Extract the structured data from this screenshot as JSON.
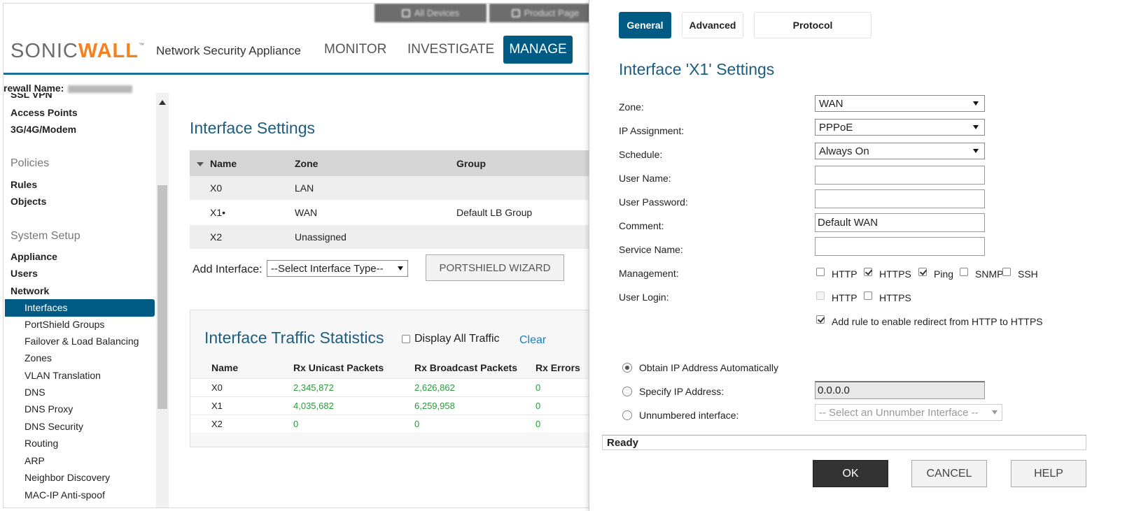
{
  "top_tabs": [
    {
      "label": "All Devices"
    },
    {
      "label": "Product Page"
    }
  ],
  "header": {
    "logo_part1": "SONIC",
    "logo_part2": "WALL",
    "logo_tm": "™",
    "product": "Network Security Appliance",
    "nav": [
      {
        "label": "MONITOR",
        "active": false
      },
      {
        "label": "INVESTIGATE",
        "active": false
      },
      {
        "label": "MANAGE",
        "active": true
      }
    ]
  },
  "firewall_name_label": "rewall Name:",
  "sidebar": {
    "cutoff_item": "SSL VPN",
    "items_top": [
      "Access Points",
      "3G/4G/Modem"
    ],
    "group_policies": "Policies",
    "policies_items": [
      "Rules",
      "Objects"
    ],
    "group_system": "System Setup",
    "system_items": [
      "Appliance",
      "Users",
      "Network"
    ],
    "active_item": "Interfaces",
    "network_items": [
      "PortShield Groups",
      "Failover & Load Balancing",
      "Zones",
      "VLAN Translation",
      "DNS",
      "DNS Proxy",
      "DNS Security",
      "Routing",
      "ARP",
      "Neighbor Discovery",
      "MAC-IP Anti-spoof"
    ]
  },
  "interface_settings": {
    "title": "Interface Settings",
    "columns": [
      "Name",
      "Zone",
      "Group"
    ],
    "rows": [
      {
        "name": "X0",
        "zone": "LAN",
        "group": ""
      },
      {
        "name": "X1•",
        "zone": "WAN",
        "group": "Default LB Group"
      },
      {
        "name": "X2",
        "zone": "Unassigned",
        "group": ""
      }
    ],
    "add_interface_label": "Add Interface:",
    "add_interface_select": "--Select Interface Type--",
    "portshield_button": "PORTSHIELD WIZARD"
  },
  "traffic_stats": {
    "title": "Interface Traffic Statistics",
    "display_all_label": "Display All Traffic",
    "clear_label": "Clear",
    "columns": [
      "Name",
      "Rx Unicast Packets",
      "Rx Broadcast Packets",
      "Rx Errors"
    ],
    "rows": [
      {
        "name": "X0",
        "rx_unicast": "2,345,872",
        "rx_broadcast": "2,626,862",
        "rx_errors": "0"
      },
      {
        "name": "X1",
        "rx_unicast": "4,035,682",
        "rx_broadcast": "6,259,958",
        "rx_errors": "0"
      },
      {
        "name": "X2",
        "rx_unicast": "0",
        "rx_broadcast": "0",
        "rx_errors": "0"
      }
    ]
  },
  "dialog": {
    "tabs": [
      {
        "label": "General",
        "active": true
      },
      {
        "label": "Advanced",
        "active": false
      },
      {
        "label": "Protocol",
        "active": false
      }
    ],
    "title": "Interface 'X1' Settings",
    "fields": {
      "zone_label": "Zone:",
      "zone_value": "WAN",
      "ip_assignment_label": "IP Assignment:",
      "ip_assignment_value": "PPPoE",
      "schedule_label": "Schedule:",
      "schedule_value": "Always On",
      "user_name_label": "User Name:",
      "user_name_value": "",
      "user_password_label": "User Password:",
      "user_password_value": "",
      "comment_label": "Comment:",
      "comment_value": "Default WAN",
      "service_name_label": "Service Name:",
      "service_name_value": ""
    },
    "management_label": "Management:",
    "management_options": [
      {
        "label": "HTTP",
        "checked": false
      },
      {
        "label": "HTTPS",
        "checked": true
      },
      {
        "label": "Ping",
        "checked": true
      },
      {
        "label": "SNMP",
        "checked": false
      },
      {
        "label": "SSH",
        "checked": false
      }
    ],
    "user_login_label": "User Login:",
    "user_login_options": [
      {
        "label": "HTTP",
        "checked": false,
        "disabled": true
      },
      {
        "label": "HTTPS",
        "checked": false,
        "disabled": false
      }
    ],
    "redirect_label": "Add rule to enable redirect from HTTP to HTTPS",
    "redirect_checked": true,
    "ip_modes": [
      {
        "label": "Obtain IP Address Automatically",
        "selected": true
      },
      {
        "label": "Specify IP Address:",
        "selected": false
      },
      {
        "label": "Unnumbered interface:",
        "selected": false
      }
    ],
    "specify_ip_value": "0.0.0.0",
    "unnumbered_select": "-- Select an Unnumber Interface --",
    "status": "Ready",
    "buttons": {
      "ok": "OK",
      "cancel": "CANCEL",
      "help": "HELP"
    }
  },
  "colors": {
    "accent": "#005b84",
    "title_blue": "#1c5d80",
    "numbers_green": "#2a9a3a",
    "logo_orange": "#f58220"
  }
}
